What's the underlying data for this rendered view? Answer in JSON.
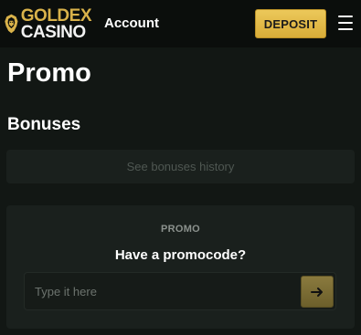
{
  "header": {
    "logo_line1": "GOLDEX",
    "logo_line2": "CASINO",
    "account_label": "Account",
    "deposit_label": "DEPOSIT",
    "menu_icon": "hamburger-menu-icon"
  },
  "page": {
    "title": "Promo",
    "section_title": "Bonuses",
    "history_button": "See bonuses history"
  },
  "promo": {
    "eyebrow": "PROMO",
    "question": "Have a promocode?",
    "input_placeholder": "Type it here",
    "input_value": "",
    "submit_icon": "arrow-right-icon"
  },
  "colors": {
    "background": "#121714",
    "header": "#0b0e0c",
    "card": "#1a201d",
    "gold": "#d9ad38",
    "submit": "#7a6b32"
  }
}
